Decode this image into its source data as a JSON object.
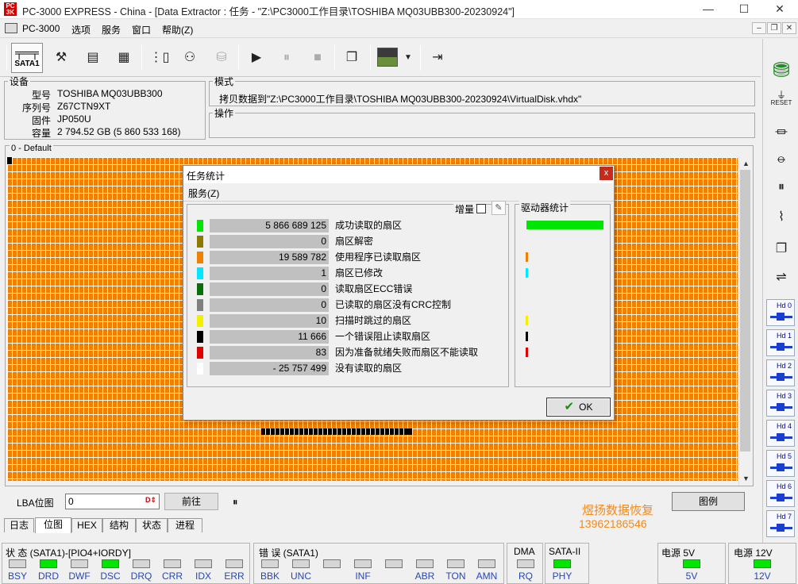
{
  "window": {
    "logo_text": "PC 3K",
    "title": "PC-3000 EXPRESS - China - [Data Extractor : 任务 - \"Z:\\PC3000工作目录\\TOSHIBA MQ03UBB300-20230924\"]",
    "minimize": "—",
    "maximize": "☐",
    "close": "✕"
  },
  "menu": {
    "app_label": "PC-3000",
    "items": [
      "选项",
      "服务",
      "窗口",
      "帮助(Z)"
    ],
    "mdi_min": "–",
    "mdi_restore": "❐",
    "mdi_close": "✕"
  },
  "toolbar": {
    "sata_label": "SATA1"
  },
  "device": {
    "title": "设备",
    "model_label": "型号",
    "model": "TOSHIBA MQ03UBB300",
    "serial_label": "序列号",
    "serial": "Z67CTN9XT",
    "firmware_label": "固件",
    "firmware": "JP050U",
    "capacity_label": "容量",
    "capacity": "2 794.52 GB (5 860 533 168)"
  },
  "mode": {
    "title": "模式",
    "text": "拷贝数据到\"Z:\\PC3000工作目录\\TOSHIBA MQ03UBB300-20230924\\VirtualDisk.vhdx\""
  },
  "operation": {
    "title": "操作"
  },
  "map": {
    "legend": "0 - Default",
    "colors": {
      "read": "#f08000",
      "skipped": "#000000"
    }
  },
  "lba": {
    "label": "LBA位图",
    "value": "0",
    "goto_button": "前往",
    "pause": "⏸",
    "legend_button": "图例"
  },
  "watermark": {
    "line1": "煜扬数据恢复",
    "line2": "13962186546"
  },
  "tabs": [
    "日志",
    "位图",
    "HEX",
    "结构",
    "状态",
    "进程"
  ],
  "active_tab": "位图",
  "right_toolbar": {
    "reset_label": "RESET",
    "heads": [
      "Hd 0",
      "Hd 1",
      "Hd 2",
      "Hd 3",
      "Hd 4",
      "Hd 5",
      "Hd 6",
      "Hd 7"
    ]
  },
  "statusbar": {
    "status_title": "状 态 (SATA1)-[PIO4+IORDY]",
    "status_leds": [
      {
        "label": "BSY",
        "on": false
      },
      {
        "label": "DRD",
        "on": true
      },
      {
        "label": "DWF",
        "on": false
      },
      {
        "label": "DSC",
        "on": true
      },
      {
        "label": "DRQ",
        "on": false
      },
      {
        "label": "CRR",
        "on": false
      },
      {
        "label": "IDX",
        "on": false
      },
      {
        "label": "ERR",
        "on": false
      }
    ],
    "error_title": "错 误 (SATA1)",
    "error_leds": [
      {
        "label": "BBK",
        "on": false
      },
      {
        "label": "UNC",
        "on": false
      },
      {
        "label": "",
        "on": false
      },
      {
        "label": "INF",
        "on": false
      },
      {
        "label": "",
        "on": false
      },
      {
        "label": "ABR",
        "on": false
      },
      {
        "label": "TON",
        "on": false
      },
      {
        "label": "AMN",
        "on": false
      }
    ],
    "dma_title": "DMA",
    "dma_led": {
      "label": "RQ",
      "on": false
    },
    "sata2_title": "SATA-II",
    "sata2_led": {
      "label": "PHY",
      "on": true
    },
    "power5_title": "电源 5V",
    "power5_led": {
      "label": "5V",
      "on": true
    },
    "power12_title": "电源 12V",
    "power12_led": {
      "label": "12V",
      "on": true
    }
  },
  "dialog": {
    "title": "任务统计",
    "close": "x",
    "menu": "服务(Z)",
    "increment_label": "增量",
    "drive_stats_title": "驱动器统计",
    "ok_button": "OK",
    "rows": [
      {
        "color": "#00e600",
        "value": "5 866 689 125",
        "label": "成功读取的扇区"
      },
      {
        "color": "#8a7a00",
        "value": "0",
        "label": "扇区解密"
      },
      {
        "color": "#f08000",
        "value": "19 589 782",
        "label": "使用程序已读取扇区"
      },
      {
        "color": "#00e8ff",
        "value": "1",
        "label": "扇区已修改"
      },
      {
        "color": "#0a6e0a",
        "value": "0",
        "label": "读取扇区ECC错误"
      },
      {
        "color": "#808080",
        "value": "0",
        "label": "已读取的扇区没有CRC控制"
      },
      {
        "color": "#f0f000",
        "value": "10",
        "label": "扫描时跳过的扇区"
      },
      {
        "color": "#000000",
        "value": "11 666",
        "label": "一个错误阻止读取扇区"
      },
      {
        "color": "#e00000",
        "value": "83",
        "label": "因为准备就绪失败而扇区不能读取"
      },
      {
        "color": "#ffffff",
        "value": "- 25 757 499",
        "label": "没有读取的扇区"
      }
    ],
    "drive_marks": [
      {
        "color": "#00e600",
        "big": true
      },
      {
        "color": "#f08000",
        "row": 2
      },
      {
        "color": "#00e8ff",
        "row": 3
      },
      {
        "color": "#f0f000",
        "row": 6
      },
      {
        "color": "#000000",
        "row": 7
      },
      {
        "color": "#e00000",
        "row": 8
      }
    ]
  }
}
